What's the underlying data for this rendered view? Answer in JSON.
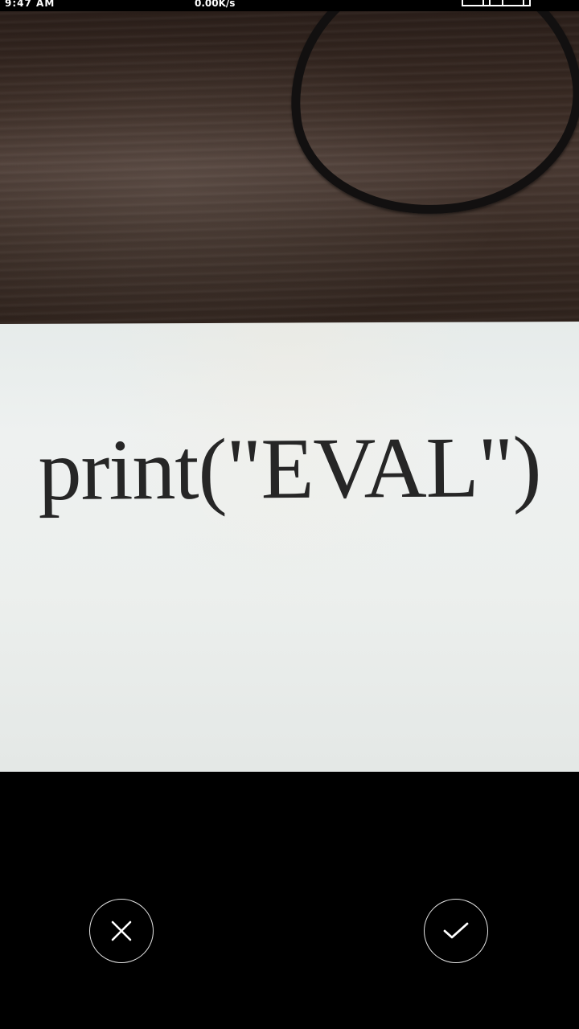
{
  "status_bar": {
    "time": "9:47 AM",
    "speed": "0.00K/s"
  },
  "photo": {
    "content_text": "print(\"EVAL\")"
  },
  "controls": {
    "cancel_icon": "close-icon",
    "confirm_icon": "checkmark-icon",
    "icon_color": "#ffffff",
    "ring_color": "#e6e6e6"
  }
}
